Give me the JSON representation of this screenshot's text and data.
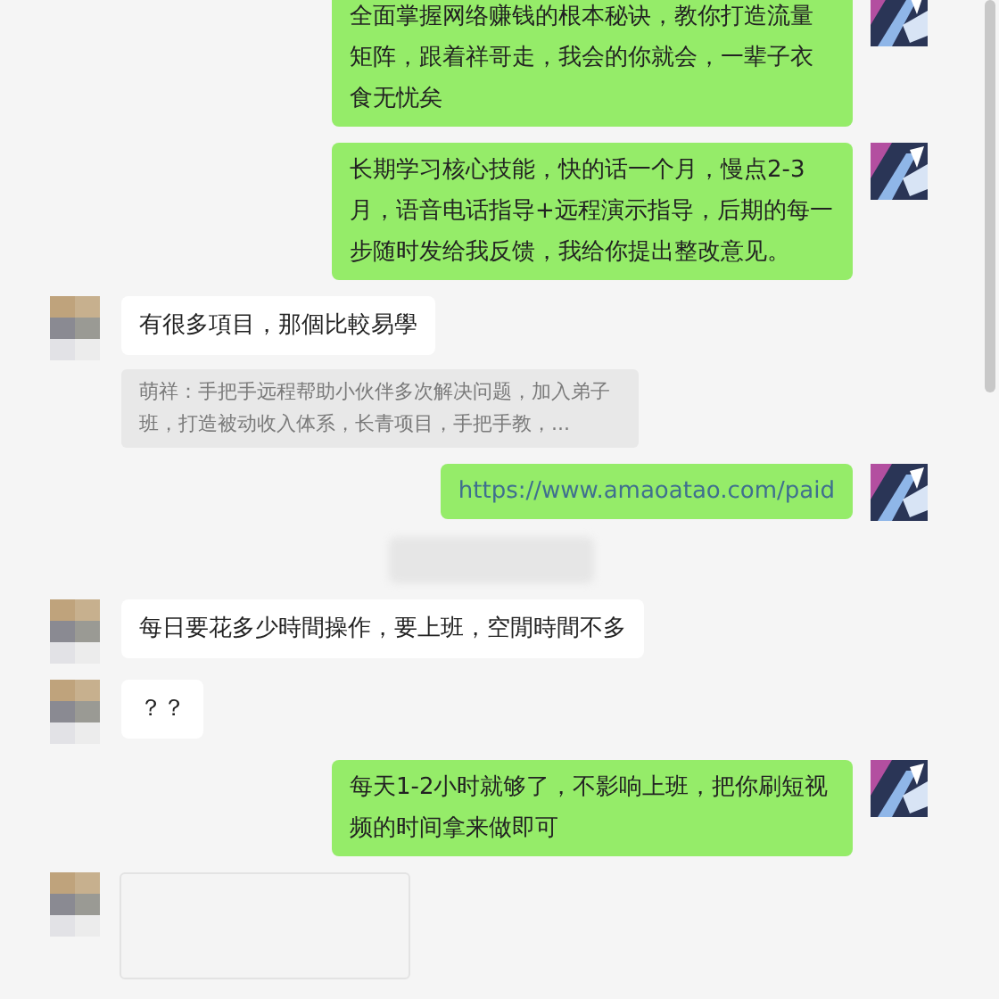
{
  "messages": [
    {
      "kind": "sent",
      "text": "全面掌握网络赚钱的根本秘诀，教你打造流量矩阵，跟着祥哥走，我会的你就会，一辈子衣食无忧矣"
    },
    {
      "kind": "sent",
      "text": "长期学习核心技能，快的话一个月，慢点2-3月，语音电话指导+远程演示指导，后期的每一步随时发给我反馈，我给你提出整改意见。"
    },
    {
      "kind": "received",
      "text": "有很多項目，那個比較易學"
    },
    {
      "kind": "quote",
      "text": "萌祥：手把手远程帮助小伙伴多次解决问题，加入弟子班，打造被动收入体系，长青项目，手把手教，..."
    },
    {
      "kind": "link",
      "text": "https://www.amaoatao.com/paid"
    },
    {
      "kind": "blur"
    },
    {
      "kind": "received",
      "text": "每日要花多少時間操作，要上班，空閒時間不多"
    },
    {
      "kind": "received",
      "text": "？？"
    },
    {
      "kind": "sent",
      "text": "每天1-2小时就够了，不影响上班，把你刷短视频的时间拿来做即可"
    },
    {
      "kind": "image"
    }
  ]
}
